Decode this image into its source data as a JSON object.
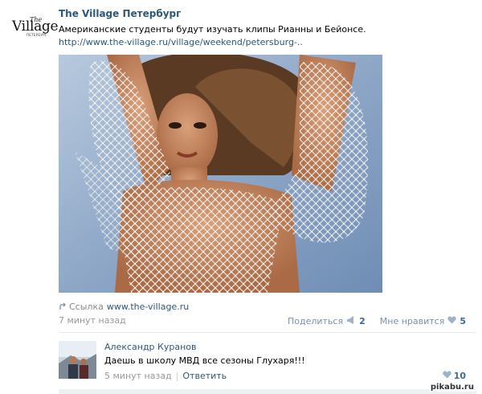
{
  "group": {
    "name": "The Village Петербург",
    "logo": {
      "the": "The",
      "village": "Village",
      "city": "ПЕТЕРБУРГ"
    }
  },
  "post": {
    "text": "Американские студенты будут изучать клипы Рианны и Бейонсе.",
    "url": "http://www.the-village.ru/village/weekend/petersburg-..",
    "link_label": "Ссылка",
    "link_domain": "www.the-village.ru",
    "time": "7 минут назад",
    "share_label": "Поделиться",
    "share_count": "2",
    "like_label": "Мне нравится",
    "like_count": "5"
  },
  "comment": {
    "author": "Александр Куранов",
    "text": "Даешь в школу МВД все сезоны Глухаря!!!",
    "time": "5 минут назад",
    "separator": "|",
    "reply_label": "Ответить",
    "like_count": "10"
  },
  "watermark": "pikabu.ru",
  "colors": {
    "link": "#2b587a",
    "muted": "#999999",
    "action": "#7993ab",
    "count": "#3d6a97",
    "photo_bg": "#8fa8c8"
  },
  "icons": {
    "share": "megaphone-icon",
    "like": "heart-icon",
    "link": "link-arrow-icon"
  }
}
